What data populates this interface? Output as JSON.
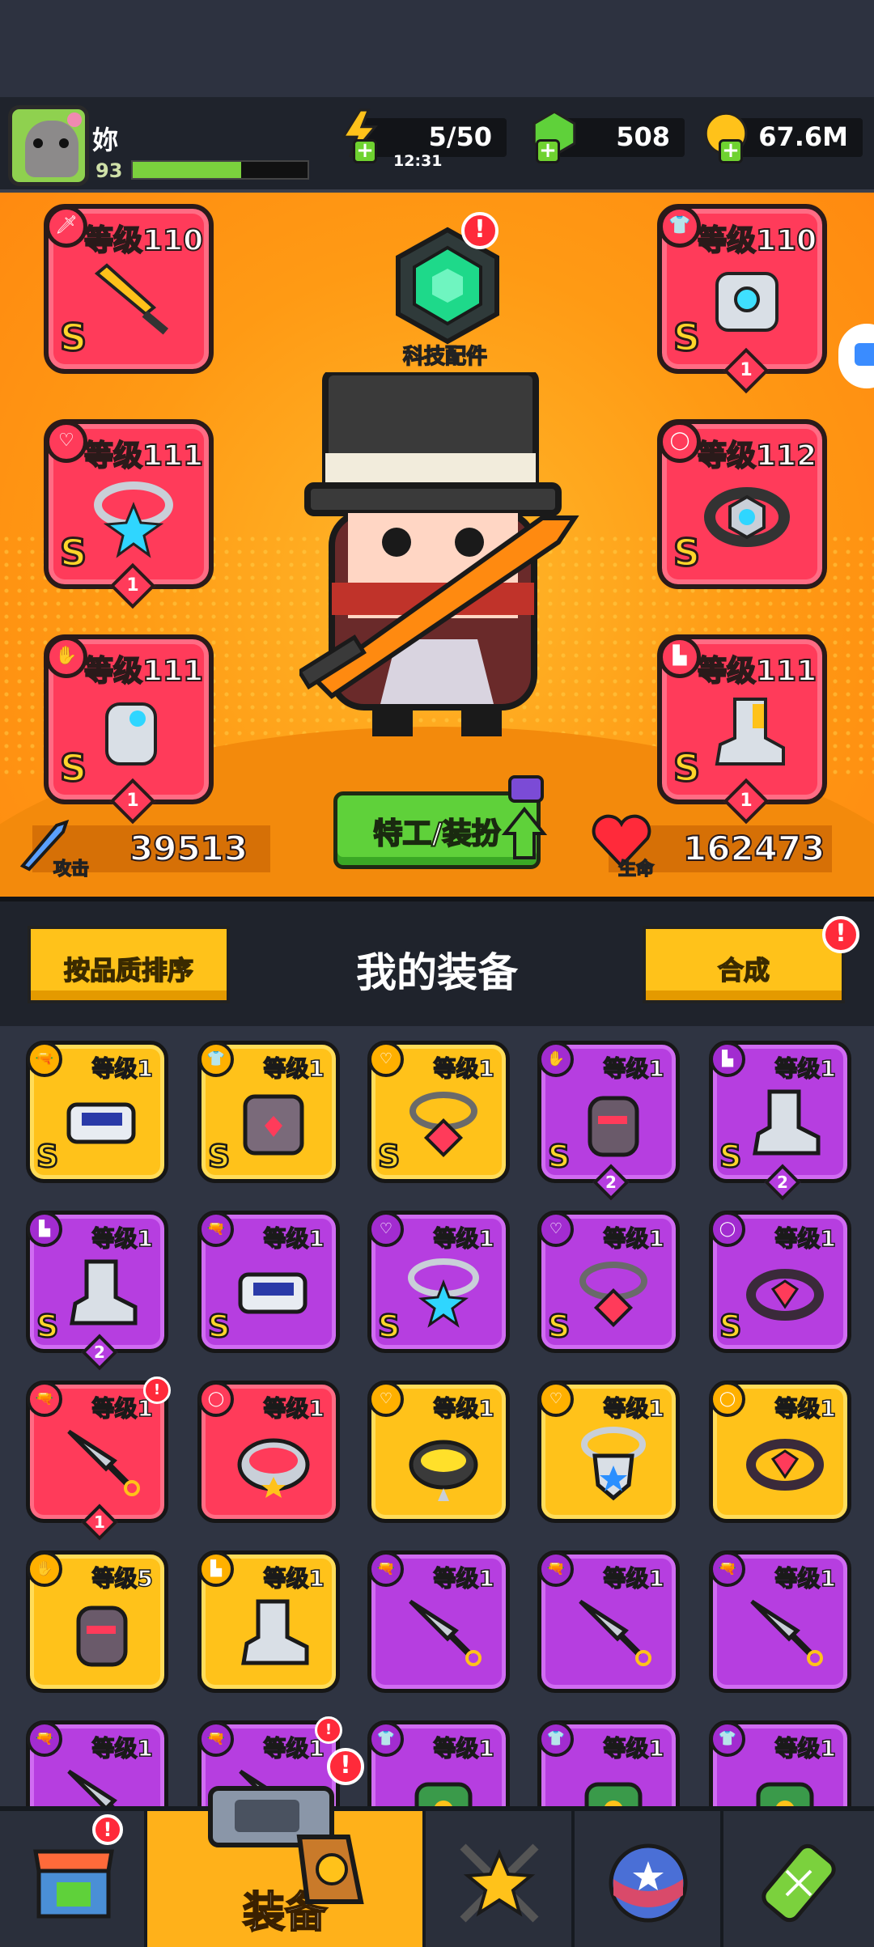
{
  "player": {
    "name": "妳",
    "level": "93",
    "xp_fraction": 0.62
  },
  "resources": {
    "energy": {
      "value": "5/50",
      "timer": "12:31",
      "icon": "lightning-icon"
    },
    "gems": {
      "value": "508",
      "icon": "gem-icon"
    },
    "coins": {
      "value": "67.6M",
      "icon": "coin-icon"
    }
  },
  "equipped": {
    "weapon": {
      "level": "等级110",
      "grade": "S",
      "icon": "sword-icon"
    },
    "armor": {
      "level": "等级110",
      "grade": "S",
      "count": "1",
      "icon": "armor-icon"
    },
    "necklace": {
      "level": "等级111",
      "grade": "S",
      "count": "1",
      "icon": "star-necklace-icon"
    },
    "belt": {
      "level": "等级112",
      "grade": "S",
      "icon": "belt-icon"
    },
    "glove": {
      "level": "等级111",
      "grade": "S",
      "count": "1",
      "icon": "glove-icon"
    },
    "boots": {
      "level": "等级111",
      "grade": "S",
      "count": "1",
      "icon": "boots-icon"
    }
  },
  "tech": {
    "label": "科技配件",
    "alert": "!"
  },
  "stats": {
    "attack_label": "攻击",
    "attack": "39513",
    "life_label": "生命",
    "life": "162473"
  },
  "agent_button": "特工/装扮",
  "gear": {
    "sort_button": "按品质排序",
    "title": "我的装备",
    "merge_button": "合成",
    "merge_alert": "!"
  },
  "inventory": [
    {
      "level": "等级1",
      "grade": "S",
      "color": "yellow",
      "icon": "blaster-icon"
    },
    {
      "level": "等级1",
      "grade": "S",
      "color": "yellow",
      "icon": "armor-icon"
    },
    {
      "level": "等级1",
      "grade": "S",
      "color": "yellow",
      "icon": "chain-necklace-icon"
    },
    {
      "level": "等级1",
      "grade": "S",
      "color": "purple",
      "count": "2",
      "icon": "glove-icon"
    },
    {
      "level": "等级1",
      "grade": "S",
      "color": "purple",
      "count": "2",
      "icon": "boots-icon"
    },
    {
      "level": "等级1",
      "grade": "S",
      "color": "purple",
      "count": "2",
      "icon": "boots-icon"
    },
    {
      "level": "等级1",
      "grade": "S",
      "color": "purple",
      "icon": "blaster-icon"
    },
    {
      "level": "等级1",
      "grade": "S",
      "color": "purple",
      "icon": "star-necklace-icon"
    },
    {
      "level": "等级1",
      "grade": "S",
      "color": "purple",
      "icon": "chain-necklace-icon"
    },
    {
      "level": "等级1",
      "grade": "S",
      "color": "purple",
      "icon": "belt-icon"
    },
    {
      "level": "等级1",
      "grade": "",
      "color": "red",
      "count": "1",
      "icon": "kunai-icon",
      "alert": true
    },
    {
      "level": "等级1",
      "grade": "",
      "color": "red",
      "icon": "collar-icon"
    },
    {
      "level": "等级1",
      "grade": "",
      "color": "yellow",
      "icon": "spiked-collar-icon"
    },
    {
      "level": "等级1",
      "grade": "",
      "color": "yellow",
      "icon": "badge-necklace-icon"
    },
    {
      "level": "等级1",
      "grade": "",
      "color": "yellow",
      "icon": "belt-icon"
    },
    {
      "level": "等级5",
      "grade": "",
      "color": "yellow",
      "icon": "glove-icon"
    },
    {
      "level": "等级1",
      "grade": "",
      "color": "yellow",
      "icon": "boots-icon"
    },
    {
      "level": "等级1",
      "grade": "",
      "color": "purple",
      "icon": "kunai-icon"
    },
    {
      "level": "等级1",
      "grade": "",
      "color": "purple",
      "icon": "kunai-icon"
    },
    {
      "level": "等级1",
      "grade": "",
      "color": "purple",
      "icon": "kunai-icon"
    },
    {
      "level": "等级1",
      "grade": "",
      "color": "purple",
      "icon": "kunai-icon"
    },
    {
      "level": "等级1",
      "grade": "",
      "color": "purple",
      "icon": "kunai-icon",
      "alert": true
    },
    {
      "level": "等级1",
      "grade": "",
      "color": "purple",
      "icon": "cactus-armor-icon"
    },
    {
      "level": "等级1",
      "grade": "",
      "color": "purple",
      "icon": "cactus-armor-icon"
    },
    {
      "level": "等级1",
      "grade": "",
      "color": "purple",
      "icon": "cactus-armor-icon"
    }
  ],
  "nav": {
    "shop_icon": "shop-icon",
    "shop_alert": "!",
    "gear_label": "装备",
    "gear_alert": "!",
    "battle_icon": "crossed-swords-star-icon",
    "stars_icon": "star-ball-icon",
    "lab_icon": "dna-capsule-icon"
  }
}
